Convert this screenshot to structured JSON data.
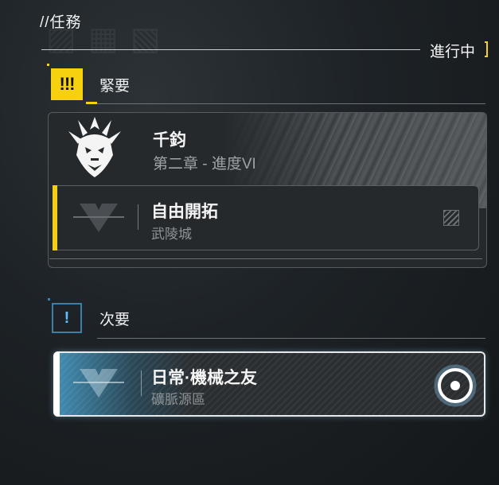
{
  "header": {
    "title": "//任務",
    "status_label": "進行中"
  },
  "categories": {
    "urgent": {
      "badge": "!!!",
      "label": "緊要"
    },
    "minor": {
      "badge": "!",
      "label": "次要"
    }
  },
  "urgent_card": {
    "name": "千鈞",
    "chapter": "第二章 - 進度VI",
    "quest": {
      "title": "自由開拓",
      "location": "武陵城"
    }
  },
  "minor_card": {
    "quest": {
      "title": "日常·機械之友",
      "location": "礦脈源區"
    }
  },
  "colors": {
    "urgent_accent": "#f5d10f",
    "minor_accent": "#5ec0ff",
    "minor_highlight": "#4eb4e6"
  },
  "icons": {
    "urgent_badge": "exclamation-triple-icon",
    "minor_badge": "exclamation-icon",
    "emblem": "dragon-emblem-icon",
    "quest_type": "triangle-v-icon",
    "tracking": "target-circle-icon"
  }
}
